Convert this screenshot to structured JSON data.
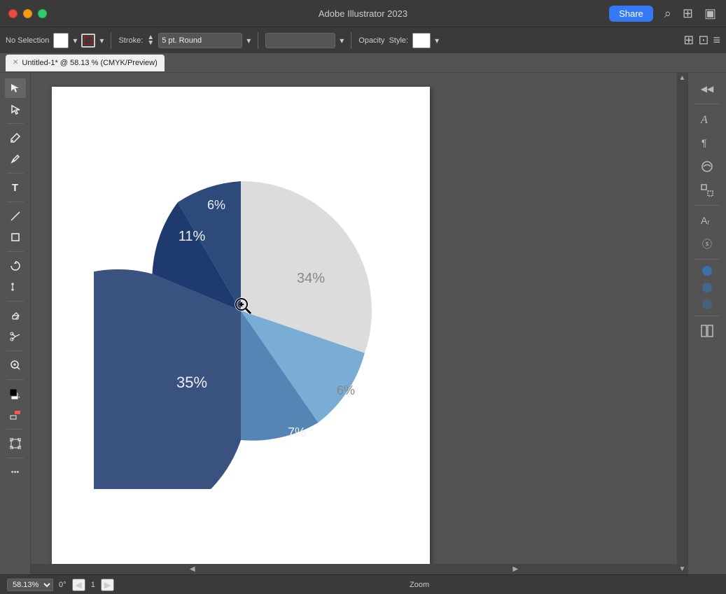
{
  "titlebar": {
    "title": "Adobe Illustrator 2023",
    "share_label": "Share"
  },
  "toolbar": {
    "no_selection_label": "No Selection",
    "stroke_label": "Stroke:",
    "stroke_value": "5 pt. Round",
    "opacity_label": "Opacity",
    "style_label": "Style:"
  },
  "tab": {
    "title": "Untitled-1* @ 58.13 % (CMYK/Preview)"
  },
  "pie": {
    "segments": [
      {
        "label": "34%",
        "value": 34,
        "color": "#e0e0e0"
      },
      {
        "label": "6%",
        "value": 6,
        "color": "#7aadd4"
      },
      {
        "label": "7%",
        "value": 7,
        "color": "#5585b5"
      },
      {
        "label": "35%",
        "value": 35,
        "color": "#3a5280"
      },
      {
        "label": "11%",
        "value": 11,
        "color": "#1e3a6e"
      },
      {
        "label": "6%",
        "value": 6,
        "color": "#2d4a7a"
      }
    ]
  },
  "bottombar": {
    "zoom": "58.13%",
    "angle": "0°",
    "page": "1",
    "zoom_label": "Zoom"
  },
  "right_panel": {
    "dots": [
      "#3d6fa8",
      "#3d6fa8",
      "#3d6fa8"
    ],
    "circle_colors": [
      "#3d6fa8",
      "#3d6fa8",
      "#3d6fa8"
    ]
  }
}
